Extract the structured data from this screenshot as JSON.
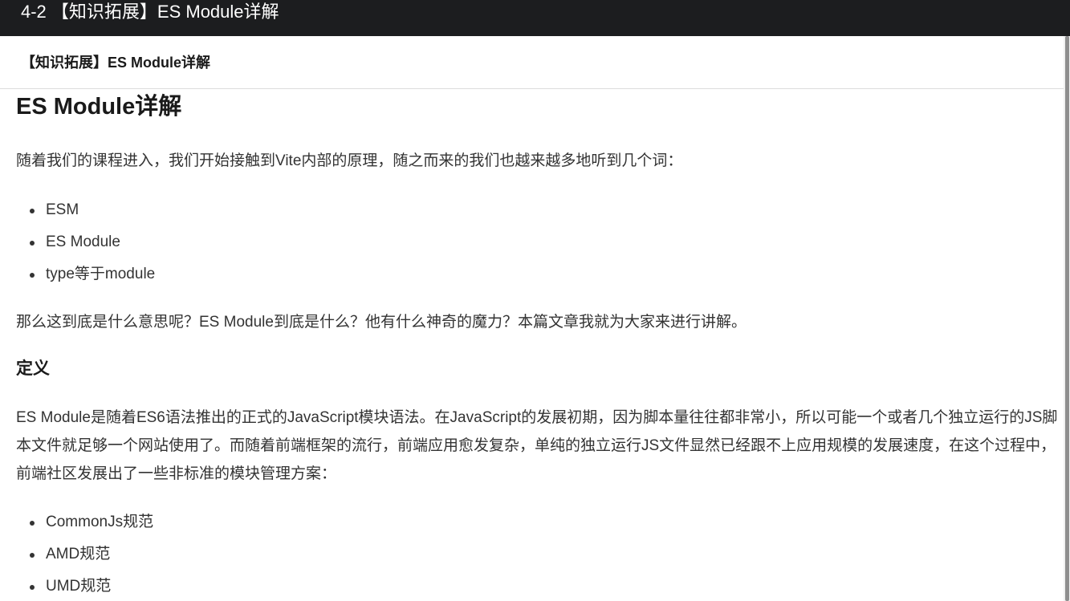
{
  "window": {
    "title": "4-2 【知识拓展】ES Module详解"
  },
  "header": {
    "title": "【知识拓展】ES Module详解"
  },
  "article": {
    "heading": "ES Module详解",
    "intro": "随着我们的课程进入，我们开始接触到Vite内部的原理，随之而来的我们也越来越多地听到几个词：",
    "terms": [
      "ESM",
      "ES Module",
      "type等于module"
    ],
    "question": "那么这到底是什么意思呢？ES Module到底是什么？他有什么神奇的魔力？本篇文章我就为大家来进行讲解。",
    "definition_heading": "定义",
    "definition_text": "ES Module是随着ES6语法推出的正式的JavaScript模块语法。在JavaScript的发展初期，因为脚本量往往都非常小，所以可能一个或者几个独立运行的JS脚本文件就足够一个网站使用了。而随着前端框架的流行，前端应用愈发复杂，单纯的独立运行JS文件显然已经跟不上应用规模的发展速度，在这个过程中，前端社区发展出了一些非标准的模块管理方案：",
    "specs": [
      "CommonJs规范",
      "AMD规范",
      "UMD规范"
    ]
  }
}
